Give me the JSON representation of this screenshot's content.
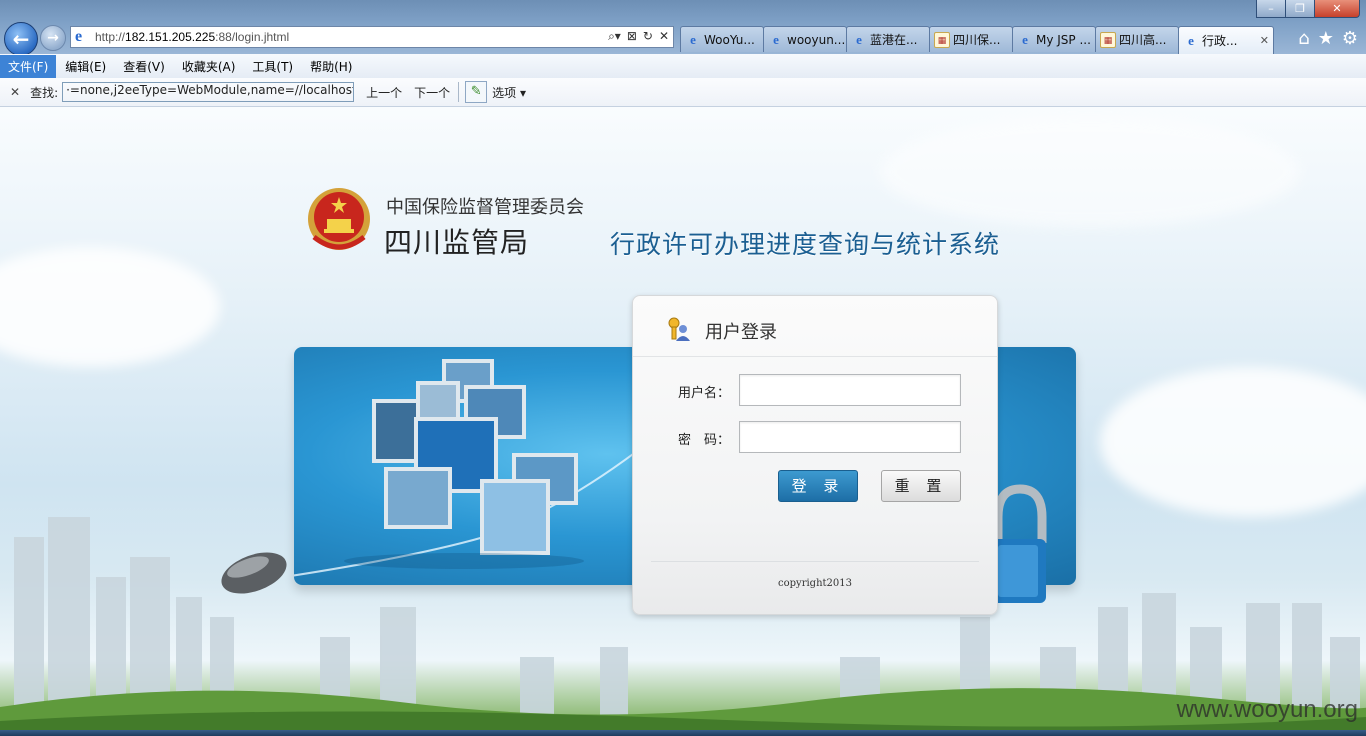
{
  "browser": {
    "address": {
      "url_prefix": "http://",
      "url_host": "182.151.205.225",
      "url_rest": ":88/login.jhtml"
    },
    "tabs": [
      {
        "label": "WooYu...",
        "icon": "ie-icon"
      },
      {
        "label": "wooyun...",
        "icon": "ie-icon"
      },
      {
        "label": "蓝港在...",
        "icon": "ie-icon"
      },
      {
        "label": "四川保...",
        "icon": "page-icon"
      },
      {
        "label": "My JSP ...",
        "icon": "ie-icon"
      },
      {
        "label": "四川高...",
        "icon": "page-icon"
      },
      {
        "label": "行政...",
        "icon": "ie-icon",
        "active": true
      }
    ],
    "menu": [
      "文件(F)",
      "编辑(E)",
      "查看(V)",
      "收藏夹(A)",
      "工具(T)",
      "帮助(H)"
    ],
    "find_bar": {
      "label": "查找:",
      "value": "·=none,j2eeType=WebModule,name=//localhost/",
      "prev": "上一个",
      "next": "下一个",
      "options": "选项"
    }
  },
  "page": {
    "org_name": "中国保险监督管理委员会",
    "bureau_name": "四川监管局",
    "system_name": "行政许可办理进度查询与统计系统",
    "login": {
      "title": "用户登录",
      "username_label": "用户名：",
      "password_label": "密　码：",
      "username_value": "",
      "password_value": "",
      "login_button": "登 录",
      "reset_button": "重 置",
      "copyright": "copyright2013"
    },
    "watermark": "www.wooyun.org"
  },
  "colors": {
    "system_title": "#1b5f92",
    "login_button": "#1d6ea6",
    "banner": "#2a96d3"
  }
}
